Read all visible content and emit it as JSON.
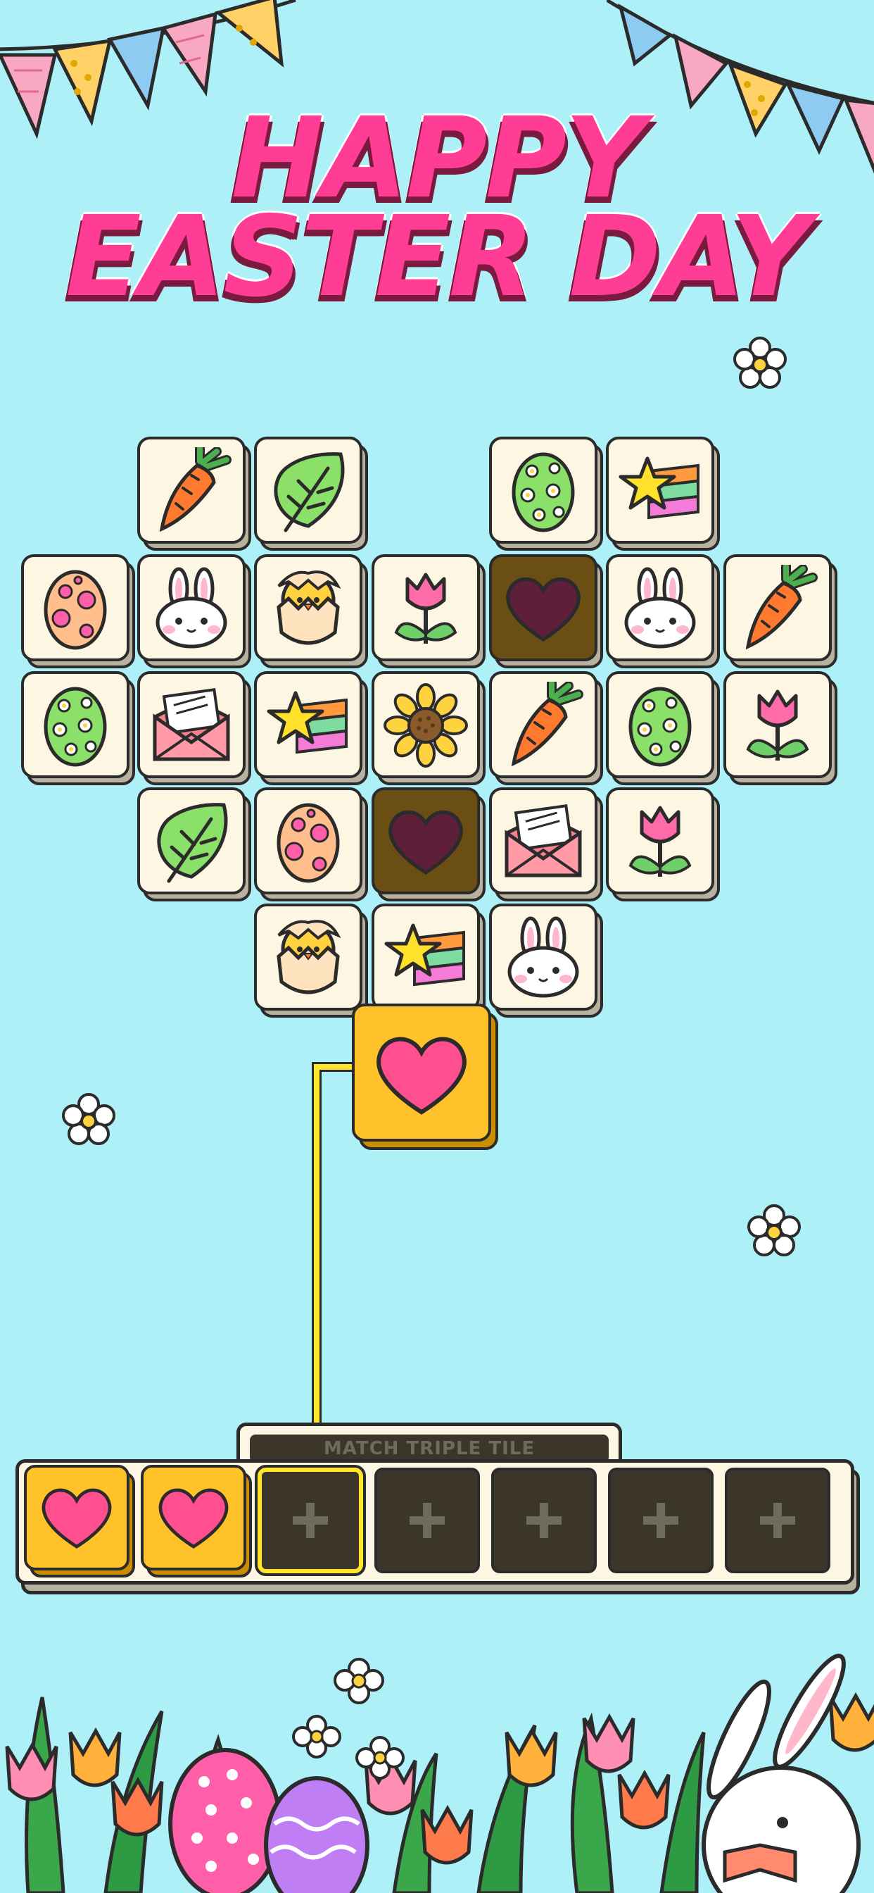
{
  "title": {
    "line1": "HAPPY",
    "line2": "EASTER DAY"
  },
  "colors": {
    "background": "#aef0f8",
    "title": "#ff3d94",
    "tile_face": "#fdf6e3",
    "tile_dark": "#6b4e14",
    "selected_tile": "#ffc22b",
    "highlight": "#ffe62b"
  },
  "board": {
    "tiles": [
      {
        "icon": "carrot-icon"
      },
      {
        "icon": "leaf-icon"
      },
      {
        "icon": "flower-egg-icon"
      },
      {
        "icon": "shooting-star-icon"
      },
      {
        "icon": "spotted-egg-icon"
      },
      {
        "icon": "bunny-icon"
      },
      {
        "icon": "hatching-chick-icon"
      },
      {
        "icon": "tulip-icon"
      },
      {
        "icon": "heart-icon",
        "state": "dark"
      },
      {
        "icon": "bunny-icon"
      },
      {
        "icon": "carrot-icon"
      },
      {
        "icon": "flower-egg-icon"
      },
      {
        "icon": "envelope-icon"
      },
      {
        "icon": "shooting-star-icon"
      },
      {
        "icon": "sunflower-icon"
      },
      {
        "icon": "carrot-icon"
      },
      {
        "icon": "flower-egg-icon"
      },
      {
        "icon": "tulip-icon"
      },
      {
        "icon": "leaf-icon"
      },
      {
        "icon": "spotted-egg-icon"
      },
      {
        "icon": "heart-icon",
        "state": "dark"
      },
      {
        "icon": "envelope-icon"
      },
      {
        "icon": "tulip-icon"
      },
      {
        "icon": "hatching-chick-icon"
      },
      {
        "icon": "shooting-star-icon"
      },
      {
        "icon": "bunny-icon"
      }
    ],
    "moving_tile": {
      "icon": "heart-icon",
      "state": "selected"
    }
  },
  "tray": {
    "label": "MATCH TRIPLE TILE",
    "slots": [
      {
        "content": "heart-icon"
      },
      {
        "content": "heart-icon"
      },
      {
        "content": "empty",
        "highlighted": true
      },
      {
        "content": "empty"
      },
      {
        "content": "empty"
      },
      {
        "content": "empty"
      },
      {
        "content": "empty"
      }
    ]
  }
}
